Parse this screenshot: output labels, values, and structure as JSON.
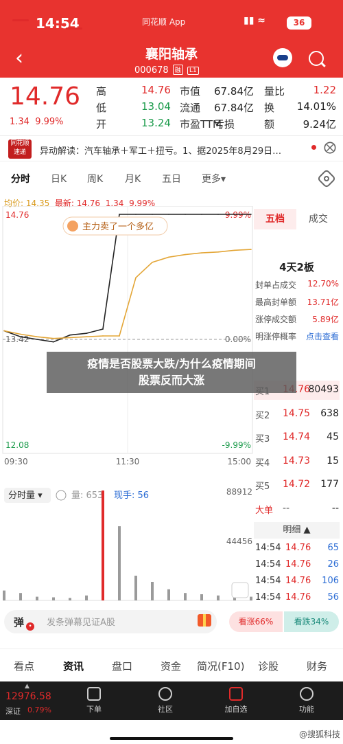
{
  "status": {
    "time": "14:54",
    "app": "同花顺 App",
    "battery": "36"
  },
  "header": {
    "name": "襄阳轴承",
    "code": "000678",
    "tag1": "融",
    "tag2": "L1"
  },
  "quote": {
    "price": "14.76",
    "change": "1.34",
    "change_pct": "9.99%",
    "rows": [
      [
        {
          "label": "高",
          "value": "14.76",
          "color": "#e02a2a"
        },
        {
          "label": "市值",
          "value": "67.84亿"
        },
        {
          "label": "量比",
          "value": "1.22",
          "color": "#e02a2a"
        }
      ],
      [
        {
          "label": "低",
          "value": "13.04",
          "color": "#1a9a4a"
        },
        {
          "label": "流通",
          "value": "67.84亿"
        },
        {
          "label": "换",
          "value": "14.01%"
        }
      ],
      [
        {
          "label": "开",
          "value": "13.24",
          "color": "#1a9a4a"
        },
        {
          "label": "市盈TTM",
          "value": "亏损"
        },
        {
          "label": "额",
          "value": "9.24亿"
        }
      ]
    ]
  },
  "news": {
    "logo": "同花顺速递",
    "text": "异动解读：汽车轴承＋军工＋扭亏。1、据2025年8月29日…",
    "close": "⨂"
  },
  "chart_tabs": [
    "分时",
    "日K",
    "周K",
    "月K",
    "五日",
    "更多▾"
  ],
  "avg_line": {
    "avg_label": "均价: 14.35",
    "latest_label": "最新: 14.76",
    "change": "1.34",
    "pct": "9.99%"
  },
  "chart": {
    "y_top": "14.76",
    "y_mid": "13.42",
    "y_bot": "12.08",
    "pct_top": "9.99%",
    "pct_mid": "0.00%",
    "pct_bot": "-9.99%",
    "times": [
      "09:30",
      "11:30",
      "15:00"
    ],
    "annotation": "主力卖了一个多亿",
    "vol_selector": "分时量 ▾",
    "vol_label": "量: 653",
    "hand_label": "现手: 56",
    "vol_max": "88912",
    "vol_mid": "44456"
  },
  "chart_data": {
    "type": "line",
    "title": "",
    "x": [
      "09:30",
      "09:40",
      "09:50",
      "10:00",
      "10:10",
      "10:20",
      "10:25",
      "10:26",
      "10:30",
      "10:40",
      "11:00",
      "11:30",
      "13:30",
      "14:00",
      "14:30",
      "14:54"
    ],
    "series": [
      {
        "name": "",
        "values": [
          13.4,
          13.33,
          13.3,
          13.27,
          13.35,
          13.37,
          13.42,
          14.76,
          14.76,
          14.76,
          14.76,
          14.76,
          14.76,
          14.76,
          14.76,
          14.76
        ]
      },
      {
        "name": "",
        "values": [
          13.4,
          13.36,
          13.33,
          13.31,
          13.32,
          13.33,
          13.34,
          13.34,
          14.02,
          14.2,
          14.26,
          14.29,
          14.31,
          14.32,
          14.34,
          14.35
        ]
      }
    ],
    "ylim": [
      12.08,
      14.76
    ],
    "volume": [
      8000,
      6000,
      3000,
      2500,
      2000,
      4000,
      88912,
      60000,
      20000,
      15000,
      9000,
      6000,
      5000,
      4000,
      9000,
      3000
    ]
  },
  "side": {
    "tabs": [
      "五档",
      "成交"
    ],
    "limit_title": "4天2板",
    "limit_rows": [
      {
        "label": "封单占成交",
        "value": "12.70%"
      },
      {
        "label": "最高封单额",
        "value": "13.71亿"
      },
      {
        "label": "涨停成交额",
        "value": "5.89亿"
      },
      {
        "label": "明涨停概率",
        "value": "点击查看"
      }
    ],
    "bids": [
      {
        "label": "买1",
        "price": "14.76",
        "qty": "80493"
      },
      {
        "label": "买2",
        "price": "14.75",
        "qty": "638"
      },
      {
        "label": "买3",
        "price": "14.74",
        "qty": "45"
      },
      {
        "label": "买4",
        "price": "14.73",
        "qty": "15"
      },
      {
        "label": "买5",
        "price": "14.72",
        "qty": "177"
      }
    ],
    "bid_total": {
      "label": "大单",
      "price": "--",
      "qty": "--"
    },
    "detail_head": "明细 ▲",
    "trades": [
      {
        "time": "14:54",
        "price": "14.76",
        "qty": "65",
        "color": "#2b6cd4"
      },
      {
        "time": "14:54",
        "price": "14.76",
        "qty": "26",
        "color": "#2b6cd4"
      },
      {
        "time": "14:54",
        "price": "14.76",
        "qty": "106",
        "color": "#2b6cd4"
      },
      {
        "time": "14:54",
        "price": "14.76",
        "qty": "56",
        "color": "#2b6cd4"
      }
    ]
  },
  "banner": {
    "line1": "疫情是否股票大跌/为什么疫情期间",
    "line2": "股票反而大涨"
  },
  "danmu": {
    "badge": "弹",
    "placeholder": "发条弹幕见证A股",
    "vote_up": "看涨66%",
    "vote_down": "看跌34%"
  },
  "info_tabs": [
    "看点",
    "资讯",
    "盘口",
    "资金",
    "简况(F10)",
    "诊股",
    "财务"
  ],
  "bottom_nav": {
    "index_value": "12976.58",
    "index_label": "深证",
    "index_change": "0.79%",
    "items": [
      "下单",
      "社区",
      "加自选",
      "功能"
    ]
  },
  "watermark": "@搜狐科技"
}
